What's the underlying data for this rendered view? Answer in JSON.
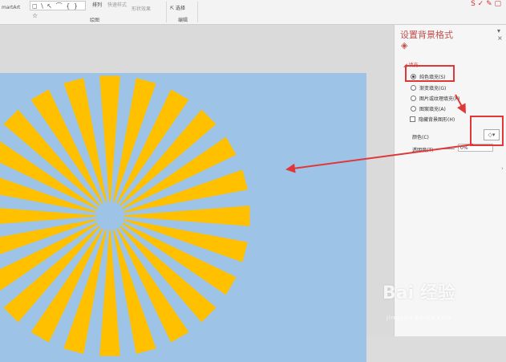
{
  "ribbon": {
    "smartart_label": "martArt",
    "shapes_gallery": "◻ \\ ↖ ⌒ { } ☆",
    "arrange_label": "排列",
    "quick_styles_label": "快速样式",
    "shape_effects_label": "形状效果",
    "drawing_group_label": "绘图",
    "select_label": "选择",
    "editing_group_label": "编辑",
    "top_icons": "S ✓ ✎ ▢"
  },
  "format_pane": {
    "title": "设置背景格式",
    "fill_section": "填充",
    "options": [
      {
        "label": "纯色填充(S)",
        "selected": true
      },
      {
        "label": "渐变填充(G)",
        "selected": false
      },
      {
        "label": "图片或纹理填充(P)",
        "selected": false
      },
      {
        "label": "图案填充(A)",
        "selected": false
      }
    ],
    "hide_background_graphics": "隐藏背景图形(H)",
    "color_label": "颜色(C)",
    "transparency_label": "透明度(T)",
    "transparency_value": "0%"
  },
  "slide": {
    "background_color": "#9dc3e6",
    "ray_color": "#ffc000",
    "ray_count": 24
  },
  "watermark": {
    "text": "Bai 经验",
    "url_text": "jingyan.baidu.com"
  },
  "colors": {
    "accent": "#c0504d",
    "annotation_red": "#e03838"
  }
}
